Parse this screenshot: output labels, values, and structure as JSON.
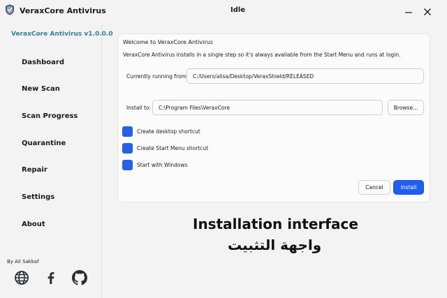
{
  "titlebar": {
    "app_title": "VeraxCore Antivirus",
    "status": "Idle",
    "icons": {
      "logo": "shield-logo-icon",
      "minimize": "minimize-icon",
      "close": "close-icon"
    }
  },
  "sidebar": {
    "version": "VeraxCore Antivirus v1.0.0.0",
    "items": [
      {
        "label": "Dashboard"
      },
      {
        "label": "New Scan"
      },
      {
        "label": "Scan Progress"
      },
      {
        "label": "Quarantine"
      },
      {
        "label": "Repair"
      },
      {
        "label": "Settings"
      },
      {
        "label": "About"
      }
    ],
    "author": "By Ali Sakkaf",
    "social_icons": [
      "globe-icon",
      "facebook-icon",
      "github-icon"
    ]
  },
  "installer": {
    "welcome": "Welcome to VeraxCore Antivirus",
    "description": "VeraxCore Antivirus installs in a single step so it's always available from the Start Menu and runs at login.",
    "running_label": "Currently running from:",
    "running_value": "C:/Users/alisa/Desktop/VeraxShield/RELEASED",
    "install_label": "Install to:",
    "install_value": "C:\\Program Files\\VeraxCore",
    "browse_label": "Browse...",
    "options": [
      {
        "label": "Create desktop shortcut",
        "checked": true
      },
      {
        "label": "Create Start Menu shortcut",
        "checked": true
      },
      {
        "label": "Start with Windows",
        "checked": true
      }
    ],
    "cancel_label": "Cancel",
    "install_button_label": "Install"
  },
  "caption": {
    "english": "Installation interface",
    "arabic": "واجهة التثبيت"
  },
  "colors": {
    "accent": "#1f5ff0",
    "version_text": "#2f7fa3",
    "background": "#f3f3f3",
    "card": "#fbfbfb"
  }
}
